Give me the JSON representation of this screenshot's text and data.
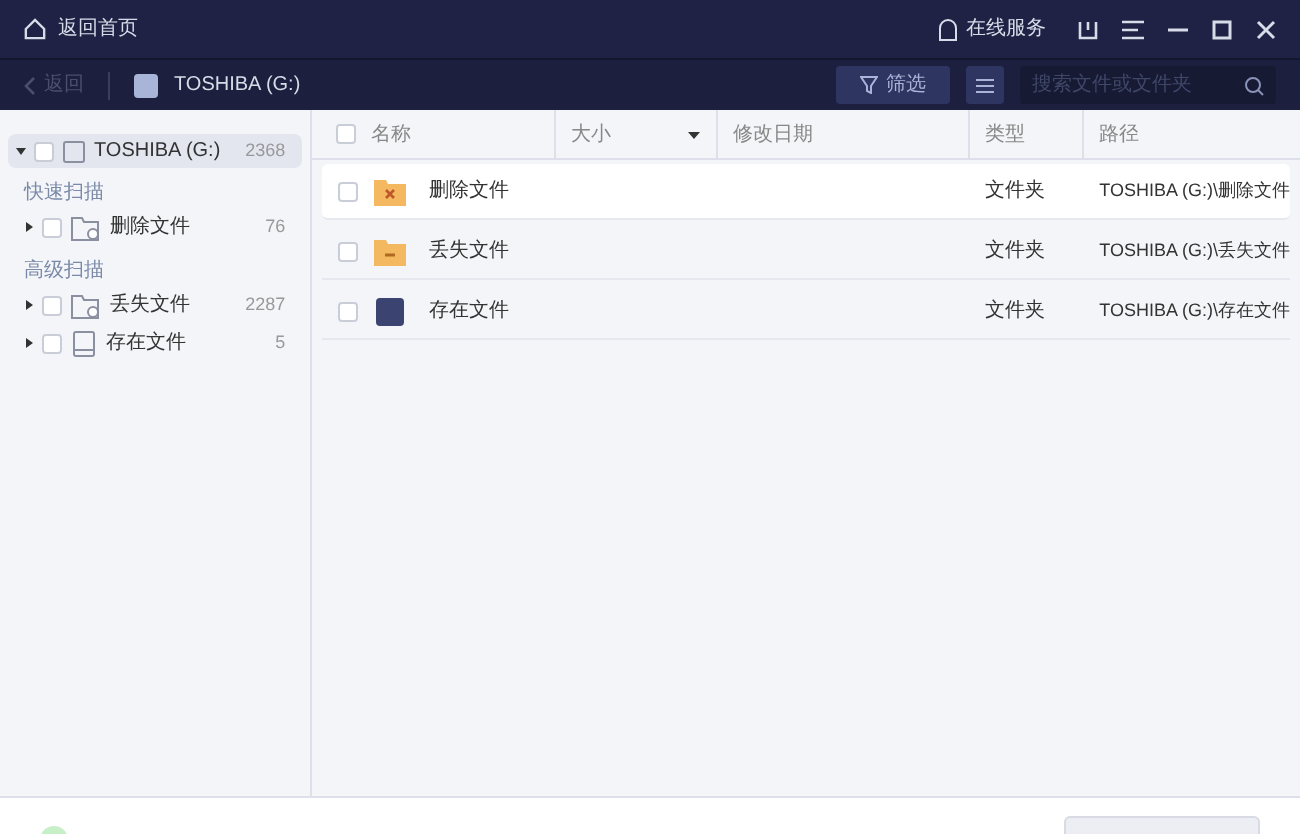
{
  "title_bar": {
    "home": "返回首页",
    "service": "在线服务"
  },
  "toolbar": {
    "back": "返回",
    "disabled_back": true,
    "drive": "TOSHIBA (G:)",
    "filter": "筛选",
    "search": {
      "placeholder": "搜索文件或文件夹"
    }
  },
  "sidebar": {
    "root": {
      "label": "TOSHIBA (G:)",
      "count": "2368",
      "checked": false,
      "expanded": true,
      "selected": true
    },
    "groups": [
      {
        "title": "快速扫描",
        "items": [
          {
            "label": "删除文件",
            "count": "76",
            "checked": false,
            "kind": "deleted"
          }
        ]
      },
      {
        "title": "高级扫描",
        "items": [
          {
            "label": "丢失文件",
            "count": "2287",
            "checked": false,
            "kind": "lost"
          },
          {
            "label": "存在文件",
            "count": "5",
            "checked": false,
            "kind": "existing"
          }
        ]
      }
    ]
  },
  "table": {
    "select_all": false,
    "columns": [
      "名称",
      "大小",
      "修改日期",
      "类型",
      "路径"
    ],
    "rows": [
      {
        "name": "删除文件",
        "type": "文件夹",
        "path": "TOSHIBA (G:)\\删除文件",
        "kind": "deleted",
        "checked": false,
        "selected": true
      },
      {
        "name": "丢失文件",
        "type": "文件夹",
        "path": "TOSHIBA (G:)\\丢失文件",
        "kind": "lost",
        "checked": false,
        "selected": false
      },
      {
        "name": "存在文件",
        "type": "文件夹",
        "path": "TOSHIBA (G:)\\存在文件",
        "kind": "existing",
        "checked": false,
        "selected": false
      }
    ]
  }
}
